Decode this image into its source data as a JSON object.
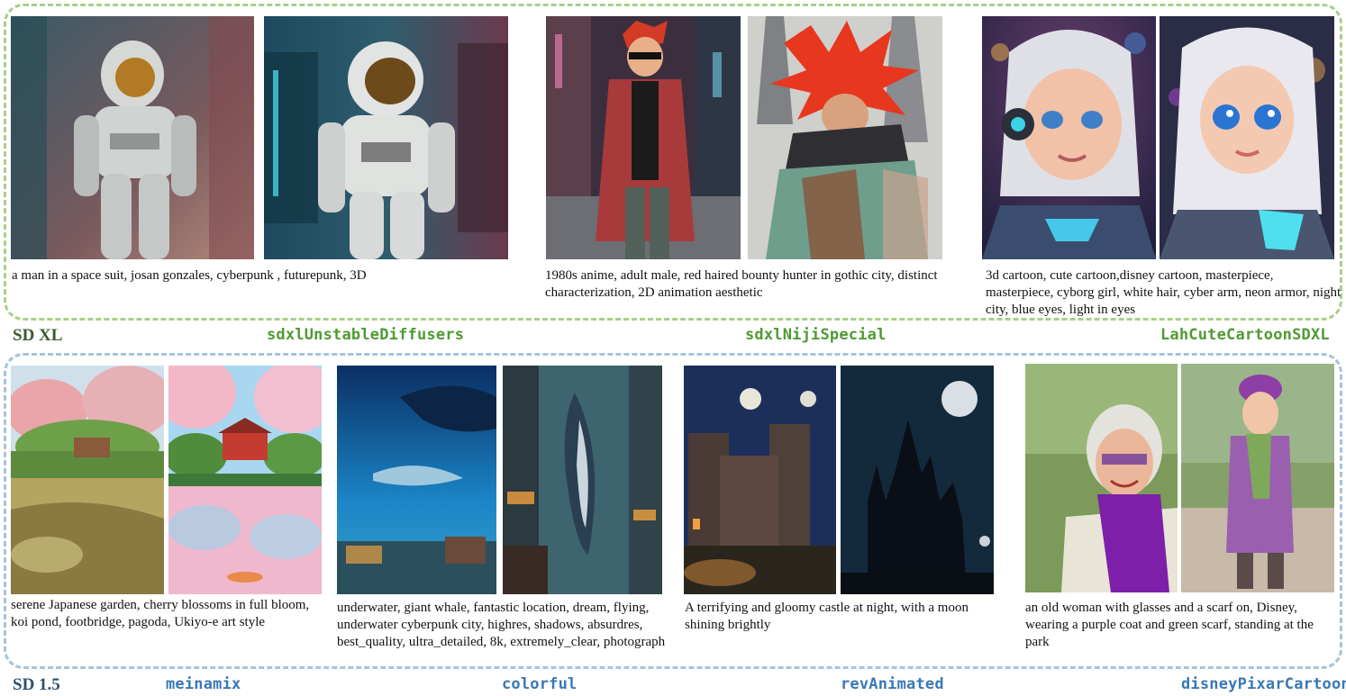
{
  "groups": {
    "sdxl": {
      "label": "SD XL"
    },
    "sd15": {
      "label": "SD 1.5"
    }
  },
  "models": {
    "sdxlUnstableDiffusers": {
      "name": "sdxlUnstableDiffusers",
      "prompt": "a man in a space suit, josan gonzales,  cyberpunk , futurepunk, 3D"
    },
    "sdxlNijiSpecial": {
      "name": "sdxlNijiSpecial",
      "prompt": "1980s anime, adult male, red haired bounty hunter in gothic city, distinct characterization, 2D animation aesthetic"
    },
    "LahCuteCartoonSDXL": {
      "name": "LahCuteCartoonSDXL",
      "prompt": "3d cartoon, cute cartoon,disney cartoon, masterpiece, masterpiece, cyborg girl, white hair, cyber arm, neon armor, night city, blue eyes, light in eyes"
    },
    "meinamix": {
      "name": "meinamix",
      "prompt": "serene Japanese garden, cherry blossoms in full bloom, koi pond, footbridge, pagoda, Ukiyo-e art style"
    },
    "colorful": {
      "name": "colorful",
      "prompt": "underwater, giant whale, fantastic location, dream, flying, underwater cyberpunk city, highres, shadows, absurdres, best_quality, ultra_detailed, 8k, extremely_clear, photograph"
    },
    "revAnimated": {
      "name": "revAnimated",
      "prompt": "A terrifying and gloomy castle at night, with a moon shining brightly"
    },
    "disneyPixarCartoon": {
      "name": "disneyPixarCartoon",
      "prompt": "an old woman with glasses and a scarf on, Disney, wearing a purple coat and green scarf, standing at the park"
    }
  },
  "colors": {
    "sdxl_border": "#a9cf8a",
    "sd15_border": "#a5c3dd",
    "sdxl_model_text": "#4f9a35",
    "sd15_model_text": "#3a78b5"
  }
}
